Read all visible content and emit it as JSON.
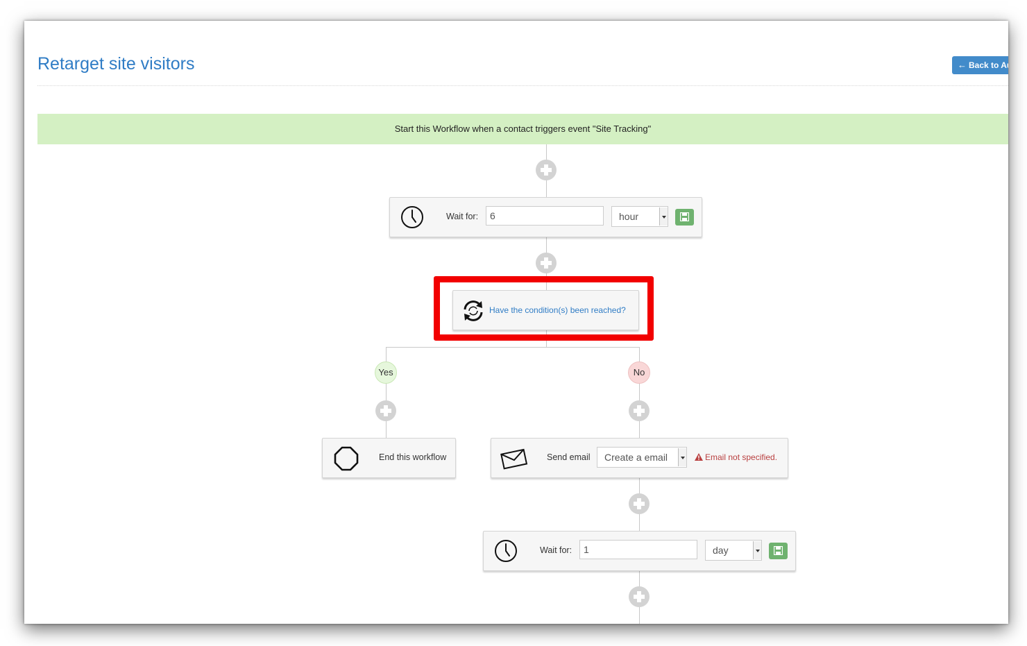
{
  "page": {
    "title": "Retarget site visitors",
    "back_button_label": "Back to Au"
  },
  "trigger": {
    "text": "Start this Workflow when a contact triggers event \"Site Tracking\""
  },
  "wait_step_1": {
    "label": "Wait for:",
    "value": "6",
    "unit": "hour",
    "icon": "clock-icon"
  },
  "condition_step": {
    "label": "Have the condition(s) been reached?",
    "icon": "refresh-cycle-icon",
    "highlight_color": "#f20000"
  },
  "branches": {
    "yes_label": "Yes",
    "no_label": "No"
  },
  "end_step": {
    "label": "End this workflow",
    "icon": "stop-octagon-icon"
  },
  "email_step": {
    "label": "Send email",
    "select_value": "Create a email",
    "warning": "Email not specified.",
    "icon": "envelope-icon"
  },
  "wait_step_2": {
    "label": "Wait for:",
    "value": "1",
    "unit": "day",
    "icon": "clock-icon"
  },
  "colors": {
    "title": "#2f7cc5",
    "trigger_banner": "#d4f0c3",
    "save_button": "#6fb26f",
    "warning": "#b94040"
  }
}
